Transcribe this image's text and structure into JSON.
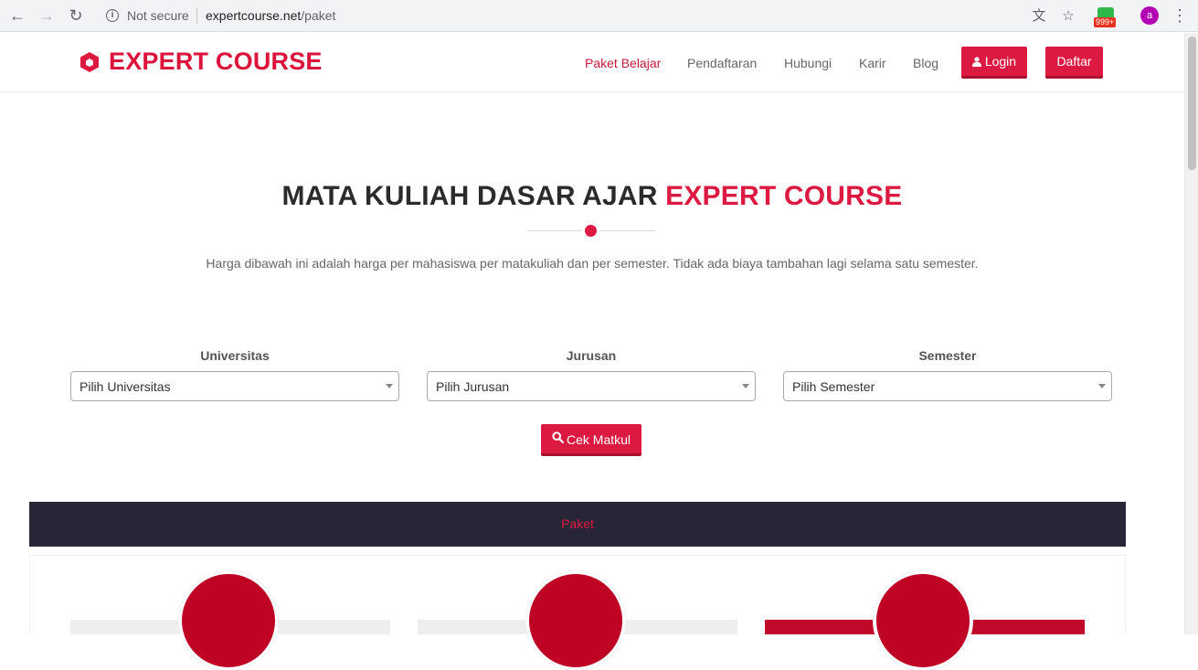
{
  "browser": {
    "not_secure": "Not secure",
    "url_domain": "expertcourse.net",
    "url_path": "/paket",
    "ext_badge": "999+",
    "avatar_letter": "a"
  },
  "header": {
    "brand": "EXPERT COURSE",
    "menu": [
      "Paket Belajar",
      "Pendaftaran",
      "Hubungi",
      "Karir",
      "Blog"
    ],
    "login_label": "Login",
    "daftar_label": "Daftar",
    "accent_color": "#dc1a41"
  },
  "hero": {
    "title_main": "MATA KULIAH DASAR AJAR ",
    "title_accent": "EXPERT COURSE",
    "subtitle": "Harga dibawah ini adalah harga per mahasiswa per matakuliah dan per semester. Tidak ada biaya tambahan lagi selama satu semester."
  },
  "form": {
    "universitas_label": "Universitas",
    "universitas_value": "Pilih Universitas",
    "jurusan_label": "Jurusan",
    "jurusan_value": "Pilih Jurusan",
    "semester_label": "Semester",
    "semester_value": "Pilih Semester",
    "submit_label": "Cek Matkul"
  },
  "paket": {
    "bar_label": "Paket"
  }
}
